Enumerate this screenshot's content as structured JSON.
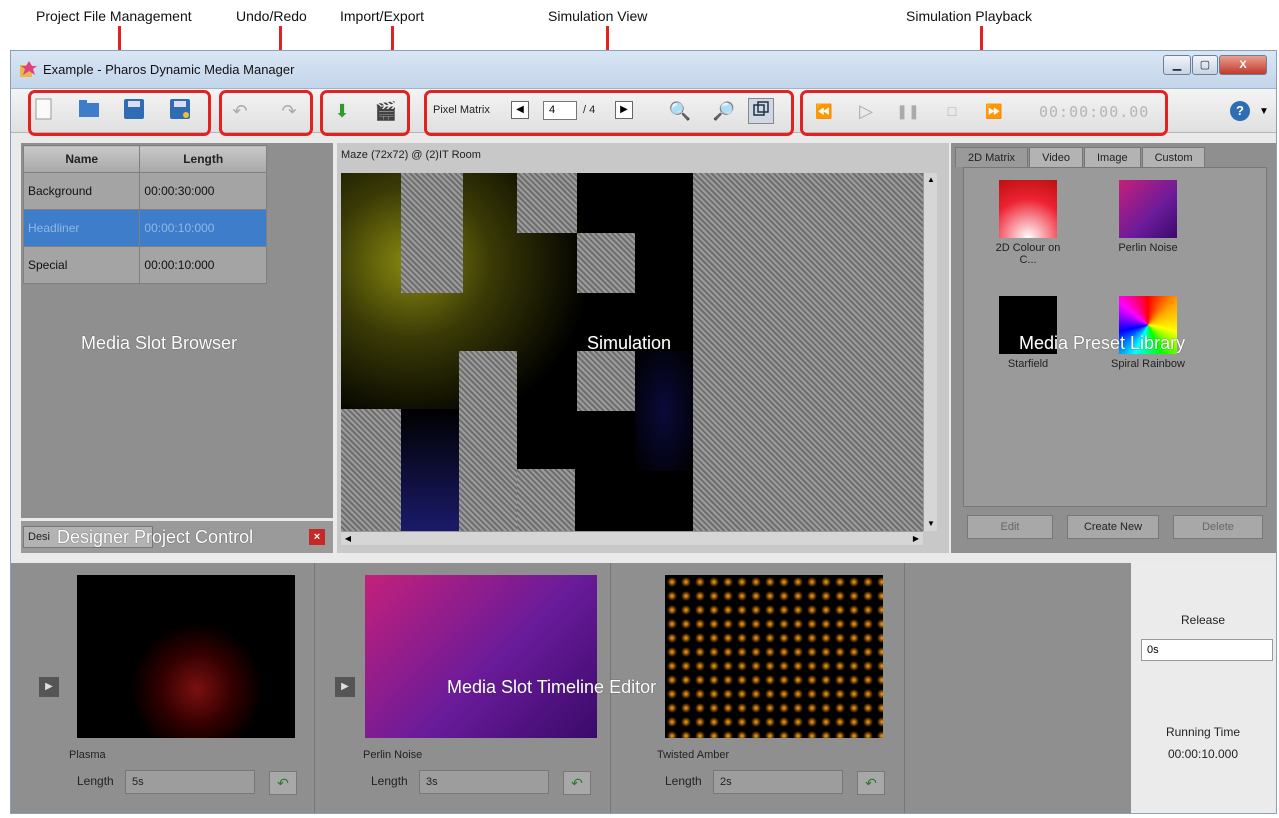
{
  "callouts": {
    "project_file": "Project File Management",
    "undo_redo": "Undo/Redo",
    "import_export": "Import/Export",
    "simulation_view": "Simulation View",
    "simulation_playback": "Simulation Playback"
  },
  "window": {
    "title": "Example - Pharos Dynamic Media Manager",
    "min": "▁",
    "max": "▢",
    "close": "X"
  },
  "toolbar": {
    "pixel_matrix_label": "Pixel Matrix",
    "current_page": "4",
    "total_pages": "/ 4",
    "timecode": "00:00:00.00",
    "help": "?"
  },
  "media_slots": {
    "columns": [
      "Name",
      "Length"
    ],
    "rows": [
      {
        "name": "Background",
        "length": "00:00:30:000"
      },
      {
        "name": "Headliner",
        "length": "00:00:10:000"
      },
      {
        "name": "Special",
        "length": "00:00:10:000"
      }
    ],
    "overlay": "Media Slot Browser"
  },
  "designer": {
    "tab_label": "Desi",
    "overlay": "Designer Project Control"
  },
  "simulation": {
    "header": "Maze (72x72) @ (2)IT Room",
    "overlay": "Simulation"
  },
  "preset_library": {
    "tabs": [
      "2D Matrix",
      "Video",
      "Image",
      "Custom"
    ],
    "items": [
      {
        "name": "2D Colour on C...",
        "icon": "gradient-red"
      },
      {
        "name": "Perlin Noise",
        "icon": "gradient-purple"
      },
      {
        "name": "Starfield",
        "icon": "starfield"
      },
      {
        "name": "Spiral Rainbow",
        "icon": "rainbow"
      }
    ],
    "buttons": {
      "edit": "Edit",
      "create": "Create New",
      "delete": "Delete"
    },
    "overlay": "Media Preset Library"
  },
  "timeline": {
    "slots": [
      {
        "name": "Plasma",
        "length_label": "Length",
        "length": "5s"
      },
      {
        "name": "Perlin Noise",
        "length_label": "Length",
        "length": "3s"
      },
      {
        "name": "Twisted Amber",
        "length_label": "Length",
        "length": "2s"
      }
    ],
    "overlay": "Media Slot Timeline Editor"
  },
  "release": {
    "label": "Release",
    "value": "0s",
    "running_label": "Running Time",
    "running_value": "00:00:10.000"
  },
  "colors": {
    "callout_red": "#e52020",
    "selection_blue": "#3d7dc9"
  }
}
